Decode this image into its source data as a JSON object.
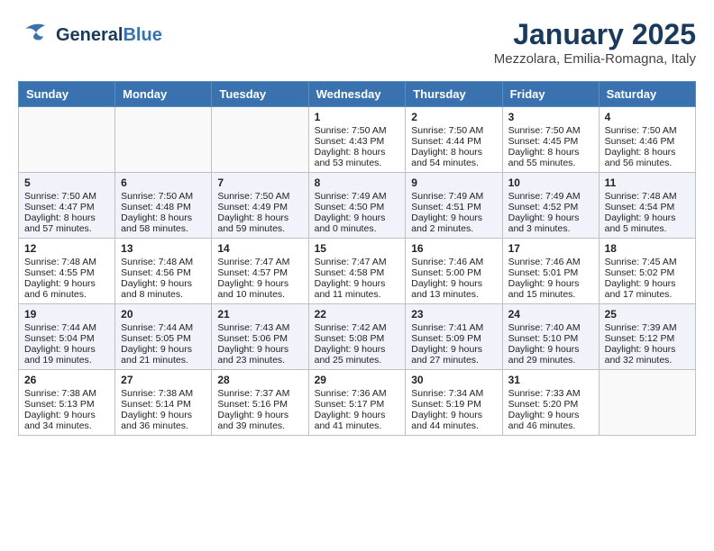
{
  "header": {
    "logo": {
      "general": "General",
      "blue": "Blue",
      "tagline": ""
    },
    "title": "January 2025",
    "subtitle": "Mezzolara, Emilia-Romagna, Italy"
  },
  "days_of_week": [
    "Sunday",
    "Monday",
    "Tuesday",
    "Wednesday",
    "Thursday",
    "Friday",
    "Saturday"
  ],
  "weeks": [
    [
      {
        "day": "",
        "sunrise": "",
        "sunset": "",
        "daylight": ""
      },
      {
        "day": "",
        "sunrise": "",
        "sunset": "",
        "daylight": ""
      },
      {
        "day": "",
        "sunrise": "",
        "sunset": "",
        "daylight": ""
      },
      {
        "day": "1",
        "sunrise": "Sunrise: 7:50 AM",
        "sunset": "Sunset: 4:43 PM",
        "daylight": "Daylight: 8 hours and 53 minutes."
      },
      {
        "day": "2",
        "sunrise": "Sunrise: 7:50 AM",
        "sunset": "Sunset: 4:44 PM",
        "daylight": "Daylight: 8 hours and 54 minutes."
      },
      {
        "day": "3",
        "sunrise": "Sunrise: 7:50 AM",
        "sunset": "Sunset: 4:45 PM",
        "daylight": "Daylight: 8 hours and 55 minutes."
      },
      {
        "day": "4",
        "sunrise": "Sunrise: 7:50 AM",
        "sunset": "Sunset: 4:46 PM",
        "daylight": "Daylight: 8 hours and 56 minutes."
      }
    ],
    [
      {
        "day": "5",
        "sunrise": "Sunrise: 7:50 AM",
        "sunset": "Sunset: 4:47 PM",
        "daylight": "Daylight: 8 hours and 57 minutes."
      },
      {
        "day": "6",
        "sunrise": "Sunrise: 7:50 AM",
        "sunset": "Sunset: 4:48 PM",
        "daylight": "Daylight: 8 hours and 58 minutes."
      },
      {
        "day": "7",
        "sunrise": "Sunrise: 7:50 AM",
        "sunset": "Sunset: 4:49 PM",
        "daylight": "Daylight: 8 hours and 59 minutes."
      },
      {
        "day": "8",
        "sunrise": "Sunrise: 7:49 AM",
        "sunset": "Sunset: 4:50 PM",
        "daylight": "Daylight: 9 hours and 0 minutes."
      },
      {
        "day": "9",
        "sunrise": "Sunrise: 7:49 AM",
        "sunset": "Sunset: 4:51 PM",
        "daylight": "Daylight: 9 hours and 2 minutes."
      },
      {
        "day": "10",
        "sunrise": "Sunrise: 7:49 AM",
        "sunset": "Sunset: 4:52 PM",
        "daylight": "Daylight: 9 hours and 3 minutes."
      },
      {
        "day": "11",
        "sunrise": "Sunrise: 7:48 AM",
        "sunset": "Sunset: 4:54 PM",
        "daylight": "Daylight: 9 hours and 5 minutes."
      }
    ],
    [
      {
        "day": "12",
        "sunrise": "Sunrise: 7:48 AM",
        "sunset": "Sunset: 4:55 PM",
        "daylight": "Daylight: 9 hours and 6 minutes."
      },
      {
        "day": "13",
        "sunrise": "Sunrise: 7:48 AM",
        "sunset": "Sunset: 4:56 PM",
        "daylight": "Daylight: 9 hours and 8 minutes."
      },
      {
        "day": "14",
        "sunrise": "Sunrise: 7:47 AM",
        "sunset": "Sunset: 4:57 PM",
        "daylight": "Daylight: 9 hours and 10 minutes."
      },
      {
        "day": "15",
        "sunrise": "Sunrise: 7:47 AM",
        "sunset": "Sunset: 4:58 PM",
        "daylight": "Daylight: 9 hours and 11 minutes."
      },
      {
        "day": "16",
        "sunrise": "Sunrise: 7:46 AM",
        "sunset": "Sunset: 5:00 PM",
        "daylight": "Daylight: 9 hours and 13 minutes."
      },
      {
        "day": "17",
        "sunrise": "Sunrise: 7:46 AM",
        "sunset": "Sunset: 5:01 PM",
        "daylight": "Daylight: 9 hours and 15 minutes."
      },
      {
        "day": "18",
        "sunrise": "Sunrise: 7:45 AM",
        "sunset": "Sunset: 5:02 PM",
        "daylight": "Daylight: 9 hours and 17 minutes."
      }
    ],
    [
      {
        "day": "19",
        "sunrise": "Sunrise: 7:44 AM",
        "sunset": "Sunset: 5:04 PM",
        "daylight": "Daylight: 9 hours and 19 minutes."
      },
      {
        "day": "20",
        "sunrise": "Sunrise: 7:44 AM",
        "sunset": "Sunset: 5:05 PM",
        "daylight": "Daylight: 9 hours and 21 minutes."
      },
      {
        "day": "21",
        "sunrise": "Sunrise: 7:43 AM",
        "sunset": "Sunset: 5:06 PM",
        "daylight": "Daylight: 9 hours and 23 minutes."
      },
      {
        "day": "22",
        "sunrise": "Sunrise: 7:42 AM",
        "sunset": "Sunset: 5:08 PM",
        "daylight": "Daylight: 9 hours and 25 minutes."
      },
      {
        "day": "23",
        "sunrise": "Sunrise: 7:41 AM",
        "sunset": "Sunset: 5:09 PM",
        "daylight": "Daylight: 9 hours and 27 minutes."
      },
      {
        "day": "24",
        "sunrise": "Sunrise: 7:40 AM",
        "sunset": "Sunset: 5:10 PM",
        "daylight": "Daylight: 9 hours and 29 minutes."
      },
      {
        "day": "25",
        "sunrise": "Sunrise: 7:39 AM",
        "sunset": "Sunset: 5:12 PM",
        "daylight": "Daylight: 9 hours and 32 minutes."
      }
    ],
    [
      {
        "day": "26",
        "sunrise": "Sunrise: 7:38 AM",
        "sunset": "Sunset: 5:13 PM",
        "daylight": "Daylight: 9 hours and 34 minutes."
      },
      {
        "day": "27",
        "sunrise": "Sunrise: 7:38 AM",
        "sunset": "Sunset: 5:14 PM",
        "daylight": "Daylight: 9 hours and 36 minutes."
      },
      {
        "day": "28",
        "sunrise": "Sunrise: 7:37 AM",
        "sunset": "Sunset: 5:16 PM",
        "daylight": "Daylight: 9 hours and 39 minutes."
      },
      {
        "day": "29",
        "sunrise": "Sunrise: 7:36 AM",
        "sunset": "Sunset: 5:17 PM",
        "daylight": "Daylight: 9 hours and 41 minutes."
      },
      {
        "day": "30",
        "sunrise": "Sunrise: 7:34 AM",
        "sunset": "Sunset: 5:19 PM",
        "daylight": "Daylight: 9 hours and 44 minutes."
      },
      {
        "day": "31",
        "sunrise": "Sunrise: 7:33 AM",
        "sunset": "Sunset: 5:20 PM",
        "daylight": "Daylight: 9 hours and 46 minutes."
      },
      {
        "day": "",
        "sunrise": "",
        "sunset": "",
        "daylight": ""
      }
    ]
  ]
}
